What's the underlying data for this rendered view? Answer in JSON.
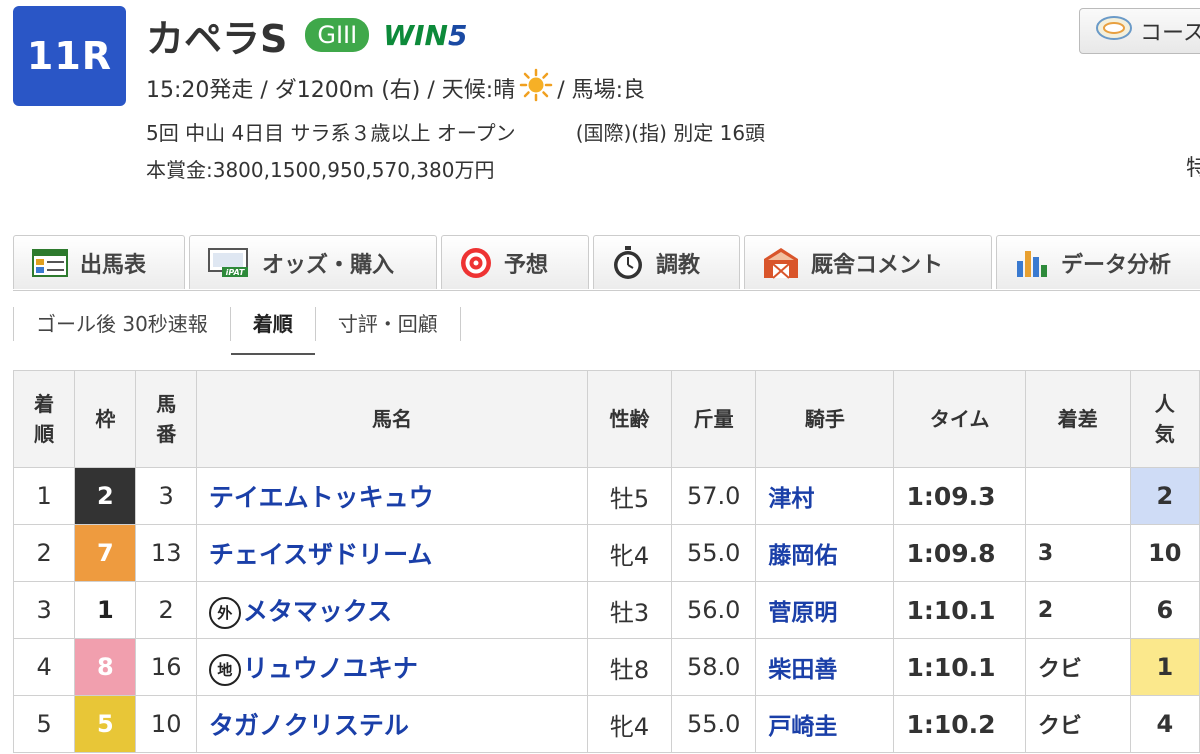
{
  "race": {
    "number": "11R",
    "name": "カペラS",
    "grade": "GIII",
    "win5_a": "WIN",
    "win5_b": "5",
    "course_button": "コース",
    "start_time": "15:20発走 / ダ1200m (右) / 天候:晴",
    "track": "/ 馬場:良",
    "meta": "5回 中山 4日目 サラ系３歳以上 オープン",
    "conditions": "(国際)(指) 別定 16頭",
    "prize": "本賞金:3800,1500,950,570,380万円",
    "edge_char": "特"
  },
  "tabs": [
    "出馬表",
    "オッズ・購入",
    "予想",
    "調教",
    "厩舎コメント",
    "データ分析"
  ],
  "subtabs": [
    "ゴール後 30秒速報",
    "着順",
    "寸評・回顧"
  ],
  "table": {
    "headers": {
      "rank": [
        "着",
        "順"
      ],
      "waku": "枠",
      "umaban": [
        "馬",
        "番"
      ],
      "name": "馬名",
      "sexage": "性齢",
      "weight": "斤量",
      "jockey": "騎手",
      "time": "タイム",
      "margin": "着差",
      "pop": [
        "人",
        "気"
      ]
    },
    "rows": [
      {
        "rank": "1",
        "waku": "2",
        "umaban": "3",
        "mark": "",
        "name": "テイエムトッキュウ",
        "sexage": "牡5",
        "weight": "57.0",
        "jockey": "津村",
        "time": "1:09.3",
        "margin": "",
        "pop": "2"
      },
      {
        "rank": "2",
        "waku": "7",
        "umaban": "13",
        "mark": "",
        "name": "チェイスザドリーム",
        "sexage": "牝4",
        "weight": "55.0",
        "jockey": "藤岡佑",
        "time": "1:09.8",
        "margin": "3",
        "pop": "10"
      },
      {
        "rank": "3",
        "waku": "1",
        "umaban": "2",
        "mark": "外",
        "name": "メタマックス",
        "sexage": "牡3",
        "weight": "56.0",
        "jockey": "菅原明",
        "time": "1:10.1",
        "margin": "2",
        "pop": "6"
      },
      {
        "rank": "4",
        "waku": "8",
        "umaban": "16",
        "mark": "地",
        "name": "リュウノユキナ",
        "sexage": "牡8",
        "weight": "58.0",
        "jockey": "柴田善",
        "time": "1:10.1",
        "margin": "クビ",
        "pop": "1"
      },
      {
        "rank": "5",
        "waku": "5",
        "umaban": "10",
        "mark": "",
        "name": "タガノクリステル",
        "sexage": "牝4",
        "weight": "55.0",
        "jockey": "戸崎圭",
        "time": "1:10.2",
        "margin": "クビ",
        "pop": "4"
      }
    ]
  },
  "colors": {
    "badge": "#2a56c6",
    "grade": "#3fa84a",
    "link": "#1a3fa8",
    "waku": {
      "1": "#ffffff",
      "2": "#333333",
      "5": "#e8c637",
      "7": "#ee9b3f",
      "8": "#f19fae"
    },
    "pop_highlight": {
      "1": "#fbe88c",
      "2": "#cfdcf6"
    }
  }
}
